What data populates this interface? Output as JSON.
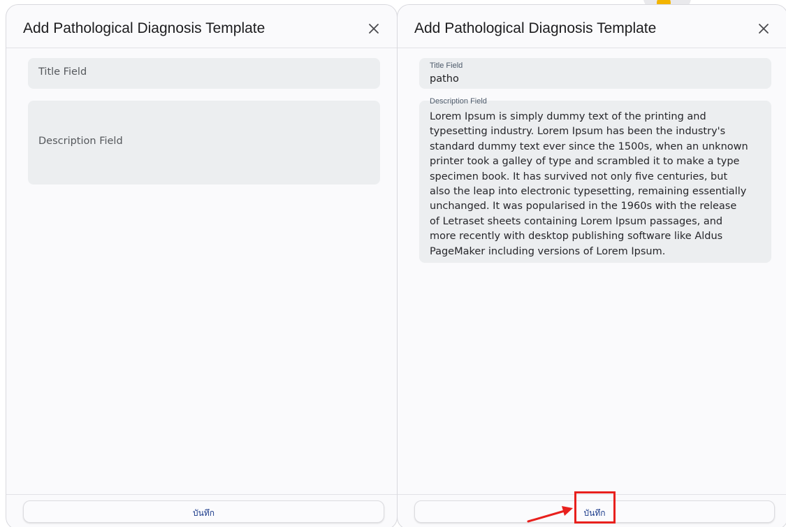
{
  "left_dialog": {
    "title": "Add Pathological Diagnosis Template",
    "title_field": {
      "placeholder": "Title Field"
    },
    "description_field": {
      "placeholder": "Description Field"
    },
    "save_label": "บันทึก",
    "close_icon": "close-icon"
  },
  "right_dialog": {
    "title": "Add Pathological Diagnosis Template",
    "title_field": {
      "label": "Title Field",
      "value": "patho"
    },
    "description_field": {
      "label": "Description Field",
      "value": "  Lorem Ipsum is simply dummy text of the printing and\ntypesetting industry. Lorem Ipsum has been the industry's\nstandard dummy text ever since the 1500s, when an unknown\nprinter took a galley of type and scrambled it to make a type\nspecimen book. It has survived not only five centuries, but\nalso the leap into electronic typesetting, remaining essentially\nunchanged. It was popularised in the 1960s with the release\nof Letraset sheets containing Lorem Ipsum passages, and\nmore recently with desktop publishing software like Aldus\nPageMaker including versions of Lorem Ipsum."
    },
    "save_label": "บันทึก",
    "close_icon": "close-icon"
  },
  "colors": {
    "dialog_bg": "#fafafc",
    "field_bg": "#eceef0",
    "save_text": "#1a3a8a",
    "annotation_red": "#e8201d"
  }
}
